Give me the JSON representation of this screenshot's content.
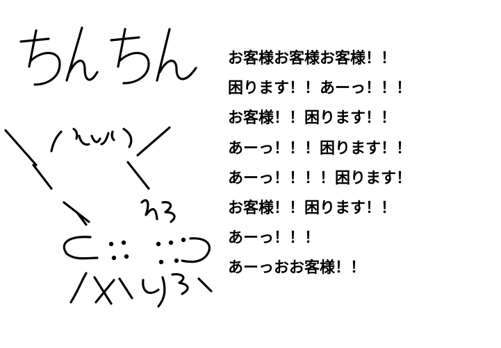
{
  "drawing": {
    "title_scribble_text": "ちんちん"
  },
  "text_lines": [
    "お客様お客様お客様！！",
    "困ります！！あーっ！！！",
    "お客様！！困ります！！",
    "あーっ！！！困ります！！",
    "あーっ！！！！困ります！",
    "お客様！！困ります！！",
    "あーっ！！！",
    "あーっおお客様！！"
  ]
}
